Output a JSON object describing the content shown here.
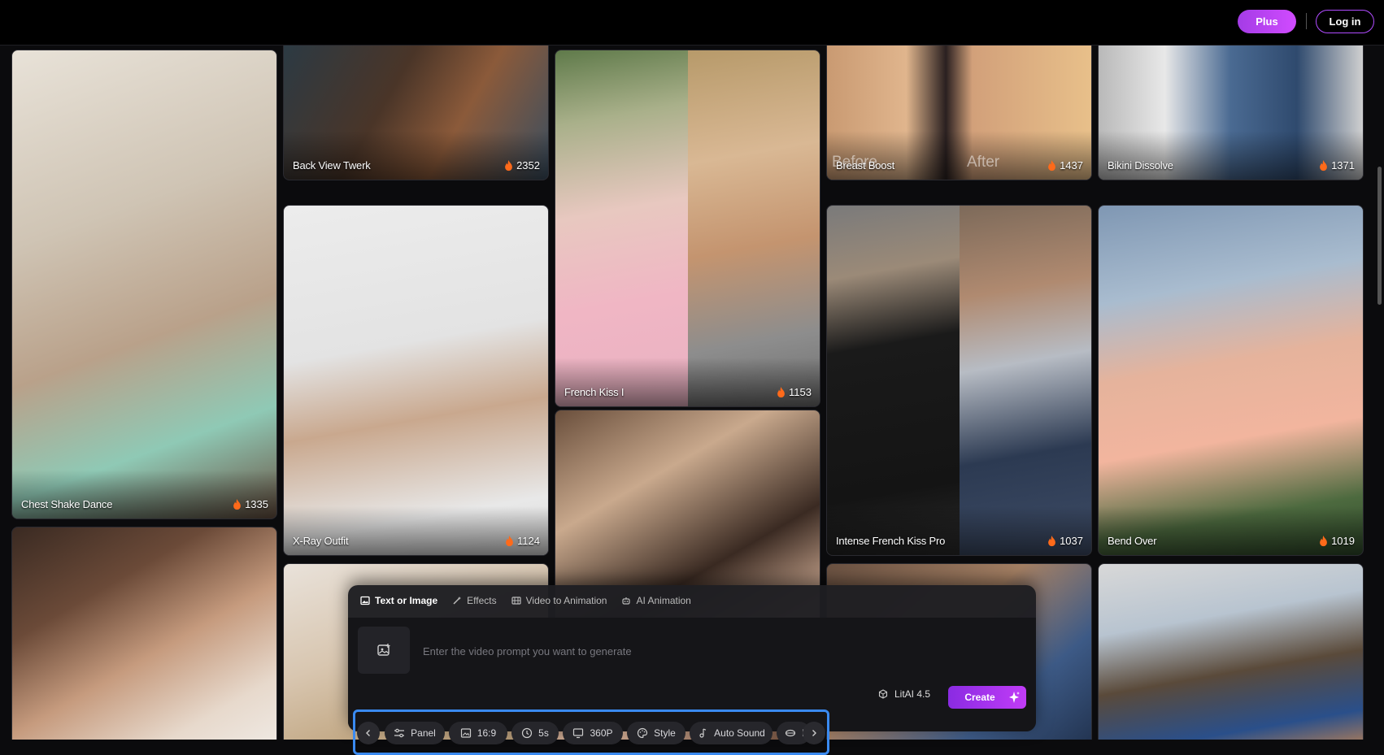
{
  "header": {
    "plus_label": "Plus",
    "login_label": "Log in"
  },
  "cards": [
    {
      "title": "Back View Twerk",
      "likes": "2352"
    },
    {
      "title": "Breast Boost",
      "likes": "1437",
      "overlay_before": "Before",
      "overlay_after": "After"
    },
    {
      "title": "Bikini Dissolve",
      "likes": "1371"
    },
    {
      "title": "Chest Shake Dance",
      "likes": "1335"
    },
    {
      "title": "French Kiss I",
      "likes": "1153"
    },
    {
      "title": "X-Ray Outfit",
      "likes": "1124"
    },
    {
      "title": "Intense French Kiss Pro",
      "likes": "1037"
    },
    {
      "title": "Bend Over",
      "likes": "1019"
    }
  ],
  "panel": {
    "tabs": [
      {
        "label": "Text or Image",
        "icon": "image-icon"
      },
      {
        "label": "Effects",
        "icon": "wand-icon"
      },
      {
        "label": "Video to Animation",
        "icon": "film-icon"
      },
      {
        "label": "AI Animation",
        "icon": "robot-icon"
      }
    ],
    "prompt_placeholder": "Enter the video prompt you want to generate",
    "chips": [
      {
        "label": "Panel",
        "icon": "sliders-icon"
      },
      {
        "label": "16:9",
        "icon": "aspect-ratio-icon"
      },
      {
        "label": "5s",
        "icon": "clock-icon"
      },
      {
        "label": "360P",
        "icon": "monitor-icon"
      },
      {
        "label": "Style",
        "icon": "palette-icon"
      },
      {
        "label": "Auto Sound",
        "icon": "music-note-icon"
      },
      {
        "label": "L",
        "icon": "lens-icon"
      }
    ],
    "model_label": "LitAI 4.5",
    "create_label": "Create"
  },
  "colors": {
    "accent_purple": "#b04cff",
    "toolbar_highlight": "#3a8af0",
    "fire": "#ff6a1a"
  }
}
